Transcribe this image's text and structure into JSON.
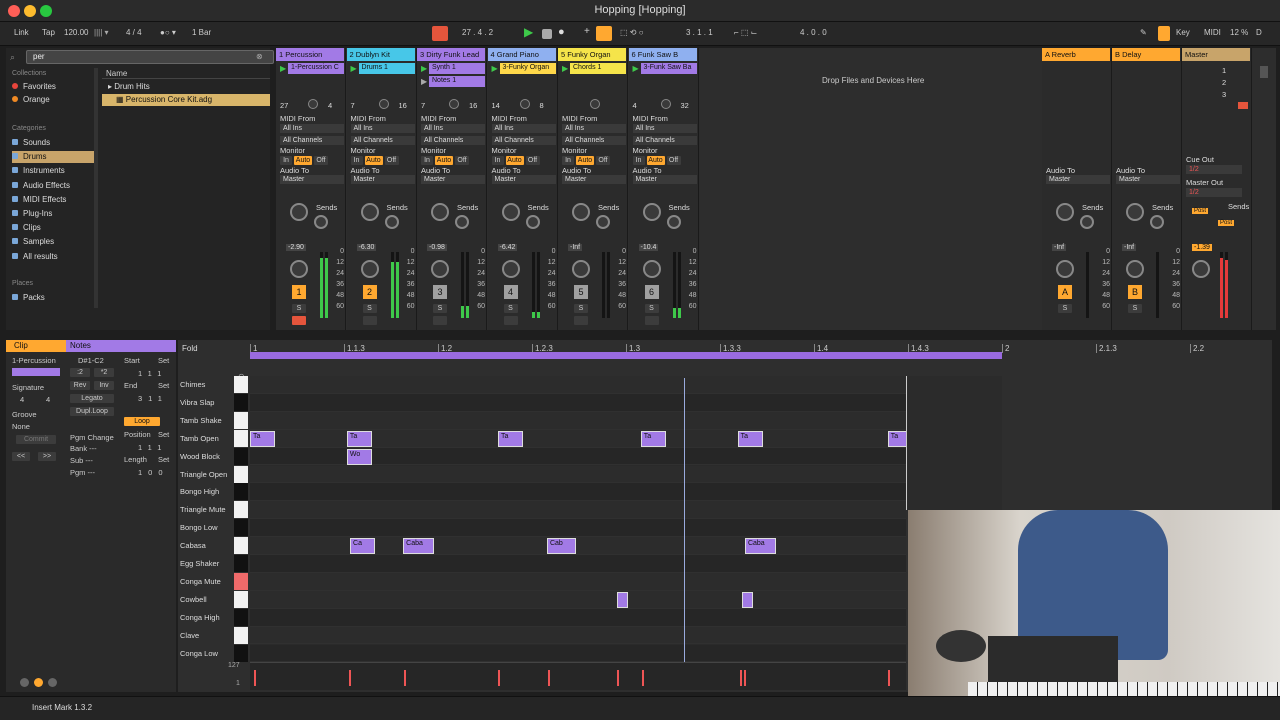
{
  "window": {
    "title": "Hopping  [Hopping]"
  },
  "control": {
    "link": "Link",
    "tap": "Tap",
    "tempo": "120.00",
    "signature": "4 / 4",
    "quant": "1 Bar",
    "position": "27 .  4 .  2",
    "loop_start": "3 .  1 .  1",
    "loop_len": "4 .  0 .  0",
    "key": "Key",
    "midi": "MIDI",
    "cpu": "12 %",
    "d": "D"
  },
  "browser": {
    "search": "per",
    "collections_label": "Collections",
    "collections": [
      {
        "label": "Favorites",
        "color": "#e8453c"
      },
      {
        "label": "Orange",
        "color": "#f08a24"
      }
    ],
    "categories_label": "Categories",
    "categories": [
      "Sounds",
      "Drums",
      "Instruments",
      "Audio Effects",
      "MIDI Effects",
      "Plug-Ins",
      "Clips",
      "Samples",
      "All results"
    ],
    "places_label": "Places",
    "places": [
      "Packs"
    ],
    "name_col": "Name",
    "files": [
      "Drum Hits",
      "Percussion Core Kit.adg"
    ]
  },
  "tracks": [
    {
      "name": "1 Percussion",
      "color": "#a27ae6",
      "clip": "1-Percussion C",
      "clip_color": "#a27ae6",
      "num": "1",
      "vol": "-2.90",
      "left": "27",
      "right": "4",
      "numcolor": "#ffa830"
    },
    {
      "name": "2 Dublyn Kit",
      "color": "#47c7e8",
      "clip": "Drums 1",
      "clip_color": "#47c7e8",
      "num": "2",
      "vol": "-6.30",
      "left": "7",
      "right": "16",
      "numcolor": "#ffa830"
    },
    {
      "name": "3 Dirty Funk Lead",
      "color": "#a27ae6",
      "clip": "Synth 1",
      "clip_color": "#a27ae6",
      "clip2": "Notes 1",
      "num": "3",
      "vol": "-0.98",
      "left": "7",
      "right": "16",
      "numcolor": "#a0a0a0"
    },
    {
      "name": "4 Grand Piano",
      "color": "#8fb0f0",
      "clip": "3-Funky Organ",
      "clip_color": "#ffd84a",
      "num": "4",
      "vol": "-6.42",
      "left": "14",
      "right": "8",
      "numcolor": "#a0a0a0"
    },
    {
      "name": "5 Funky Organ",
      "color": "#f5e44a",
      "clip": "Chords 1",
      "clip_color": "#f5e44a",
      "num": "5",
      "vol": "-Inf",
      "left": "",
      "right": "",
      "numcolor": "#a0a0a0"
    },
    {
      "name": "6 Funk Saw B",
      "color": "#8fb0f0",
      "clip": "3-Funk Saw Ba",
      "clip_color": "#a27ae6",
      "num": "6",
      "vol": "-10.4",
      "left": "4",
      "right": "32",
      "numcolor": "#a0a0a0"
    }
  ],
  "mixer_labels": {
    "midi_from": "MIDI From",
    "all_ins": "All Ins",
    "all_channels": "All Channels",
    "monitor": "Monitor",
    "in": "In",
    "auto": "Auto",
    "off": "Off",
    "audio_to": "Audio To",
    "master": "Master",
    "sends": "Sends",
    "a": "A",
    "b": "B",
    "s": "S",
    "drop": "Drop Files and Devices Here"
  },
  "returns": [
    {
      "name": "A Reverb",
      "num": "A",
      "vol": "-Inf"
    },
    {
      "name": "B Delay",
      "num": "B",
      "vol": "-Inf"
    }
  ],
  "master": {
    "name": "Master",
    "scenes": [
      "1",
      "2",
      "3"
    ],
    "cue_out": "Cue Out",
    "cue_val": "1/2",
    "master_out": "Master Out",
    "master_val": "1/2",
    "vol": "-1.39",
    "post": "Post"
  },
  "meter_ticks": [
    "0",
    "12",
    "24",
    "36",
    "48",
    "60"
  ],
  "clipview": {
    "clip": "Clip",
    "notes": "Notes",
    "name": "1-Percussion",
    "range": "D#1-C2",
    "start": "Start",
    "set": "Set",
    "signature": "Signature",
    "sig_num": "4",
    "sig_den": "4",
    "groove": "Groove",
    "groove_val": "None",
    "commit": "Commit",
    "half": ":2",
    "double": "*2",
    "rev": "Rev",
    "inv": "Inv",
    "legato": "Legato",
    "dupl": "Dupl.Loop",
    "end": "End",
    "loop": "Loop",
    "position": "Position",
    "length": "Length",
    "pgm": "Pgm Change",
    "bank": "Bank ---",
    "sub": "Sub ---",
    "pgm2": "Pgm ---",
    "start_v": [
      "1",
      "1",
      "1"
    ],
    "end_v": [
      "3",
      "1",
      "1"
    ],
    "pos_v": [
      "1",
      "1",
      "1"
    ],
    "len_v": [
      "1",
      "0",
      "0"
    ]
  },
  "editor": {
    "fold": "Fold",
    "ruler": [
      {
        "label": "1",
        "pos": 0
      },
      {
        "label": "1.1.3",
        "pos": 94
      },
      {
        "label": "1.2",
        "pos": 188
      },
      {
        "label": "1.2.3",
        "pos": 282
      },
      {
        "label": "1.3",
        "pos": 376
      },
      {
        "label": "1.3.3",
        "pos": 470
      },
      {
        "label": "1.4",
        "pos": 564
      },
      {
        "label": "1.4.3",
        "pos": 658
      },
      {
        "label": "2",
        "pos": 752
      },
      {
        "label": "2.1.3",
        "pos": 846
      },
      {
        "label": "2.2",
        "pos": 940
      }
    ],
    "rows": [
      "Chimes",
      "Vibra Slap",
      "Tamb Shake",
      "Tamb Open",
      "Wood Block",
      "Triangle Open",
      "Bongo High",
      "Triangle Mute",
      "Bongo Low",
      "Cabasa",
      "Egg Shaker",
      "Conga Mute",
      "Cowbell",
      "Conga High",
      "Clave",
      "Conga Low"
    ],
    "vel_top": "127",
    "vel_bot": "1"
  },
  "notes": [
    {
      "row": 3,
      "start": 0.0,
      "len": 0.024,
      "label": "Ta"
    },
    {
      "row": 3,
      "start": 0.093,
      "len": 0.024,
      "label": "Ta"
    },
    {
      "row": 3,
      "start": 0.238,
      "len": 0.024,
      "label": "Ta"
    },
    {
      "row": 3,
      "start": 0.375,
      "len": 0.024,
      "label": "Ta"
    },
    {
      "row": 3,
      "start": 0.468,
      "len": 0.024,
      "label": "Ta"
    },
    {
      "row": 3,
      "start": 0.612,
      "len": 0.024,
      "label": "Ta"
    },
    {
      "row": 4,
      "start": 0.093,
      "len": 0.024,
      "label": "Wo"
    },
    {
      "row": 9,
      "start": 0.096,
      "len": 0.024,
      "label": "Ca"
    },
    {
      "row": 9,
      "start": 0.147,
      "len": 0.03,
      "label": "Caba"
    },
    {
      "row": 9,
      "start": 0.285,
      "len": 0.028,
      "label": "Cab"
    },
    {
      "row": 9,
      "start": 0.475,
      "len": 0.03,
      "label": "Caba"
    },
    {
      "row": 12,
      "start": 0.352,
      "len": 0.011,
      "label": ""
    },
    {
      "row": 12,
      "start": 0.472,
      "len": 0.011,
      "label": ""
    }
  ],
  "velocities": [
    0.004,
    0.095,
    0.148,
    0.238,
    0.286,
    0.352,
    0.376,
    0.47,
    0.474,
    0.612
  ],
  "status": {
    "text": "Insert Mark 1.3.2"
  }
}
